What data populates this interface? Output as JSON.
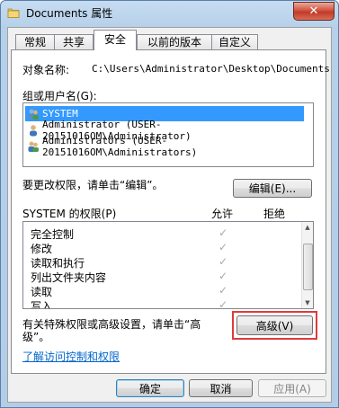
{
  "window": {
    "title": "Documents 属性",
    "close_symbol": "✕"
  },
  "tabs": [
    {
      "label": "常规"
    },
    {
      "label": "共享"
    },
    {
      "label": "安全"
    },
    {
      "label": "以前的版本"
    },
    {
      "label": "自定义"
    }
  ],
  "security": {
    "object_name_label": "对象名称:",
    "object_name_value": "C:\\Users\\Administrator\\Desktop\\Documents",
    "groups_label": "组或用户名(G):",
    "groups": [
      {
        "name": "SYSTEM",
        "selected": true,
        "icon": "user-group-icon"
      },
      {
        "name": "Administrator (USER-20151016OM\\Administrator)",
        "selected": false,
        "icon": "user-icon"
      },
      {
        "name": "Administrators (USER-20151016OM\\Administrators)",
        "selected": false,
        "icon": "user-group-icon"
      }
    ],
    "edit_hint": "要更改权限，请单击“编辑”。",
    "edit_button": "编辑(E)...",
    "permissions_label": "SYSTEM 的权限(P)",
    "allow_header": "允许",
    "deny_header": "拒绝",
    "permissions": [
      {
        "name": "完全控制",
        "allow": "✓",
        "deny": ""
      },
      {
        "name": "修改",
        "allow": "✓",
        "deny": ""
      },
      {
        "name": "读取和执行",
        "allow": "✓",
        "deny": ""
      },
      {
        "name": "列出文件夹内容",
        "allow": "✓",
        "deny": ""
      },
      {
        "name": "读取",
        "allow": "✓",
        "deny": ""
      },
      {
        "name": "写入",
        "allow": "✓",
        "deny": ""
      }
    ],
    "advanced_hint_line1": "有关特殊权限或高级设置，请单击“高",
    "advanced_hint_line2": "级”。",
    "advanced_button": "高级(V)",
    "access_link": "了解访问控制和权限"
  },
  "footer": {
    "ok": "确定",
    "cancel": "取消",
    "apply": "应用(A)"
  },
  "colors": {
    "selection": "#3399ff",
    "highlight_box": "#e03a3a",
    "link": "#0066cc"
  }
}
